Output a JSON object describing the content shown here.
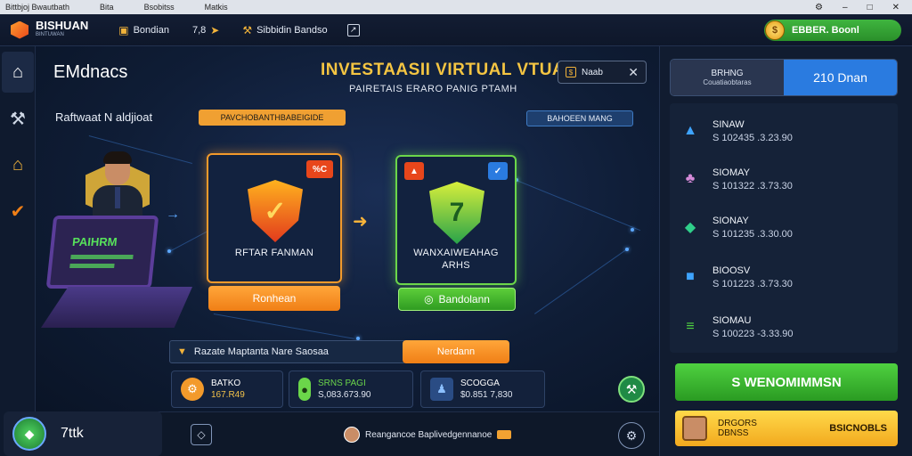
{
  "titlebar": {
    "items": [
      "Bittbjoj Bwautbath",
      "Bita",
      "Bsobitss",
      "Matkis"
    ],
    "controls": [
      "⚙",
      "–",
      "□",
      "✕"
    ]
  },
  "header": {
    "logo": "BISHUAN",
    "logo_sub": "BINTUWAN",
    "items": [
      "Bondian",
      "7,8",
      "Sibbidin Bandso"
    ],
    "balance": "EBBER. Boonl",
    "coin_label": "$"
  },
  "sidebar": {
    "items": [
      "home",
      "tools",
      "house",
      "ticket"
    ]
  },
  "main": {
    "heading": "EMdnacs",
    "title": "INVESTAASII VIRTUAL VTUAL",
    "subtitle": "PAIRETAIS ERARO PANIG PTAMH",
    "chip_label": "Naab",
    "sub_heading": "Raftwaat N aldjioat",
    "orange_tag": "PAVCHOBANTHBABEIGIDE",
    "blue_tag": "BAHOEEN MANG",
    "laptop_text": "PAIHRM",
    "left_card": {
      "corner": "%C",
      "label": "RFTAR FANMAN",
      "button": "Ronhean"
    },
    "right_card": {
      "label_line1": "WANXAIWEAHAG",
      "label_line2": "ARHS",
      "button": "Bandolann"
    },
    "info_bar": "Razate Maptanta Nare Saosaa",
    "info_button": "Nerdann",
    "stats": [
      {
        "title": "BATKO",
        "value": "167.R49",
        "icon": "●"
      },
      {
        "title": "SRNS PAGI",
        "value": "S,083.673.90",
        "icon": "•"
      },
      {
        "title": "SCOGGA",
        "value": "$0.851 7,830",
        "icon": "♟"
      }
    ]
  },
  "bottom": {
    "badge_label": "7ttk",
    "message": "Reangancoe Baplivedgennanoe"
  },
  "rpanel": {
    "tab_inactive_title": "BRHNG",
    "tab_inactive_sub": "Couatiaobtaras",
    "tab_active": "210 Dnan",
    "items": [
      {
        "name": "SINAW",
        "value": "S 102435 .3.23.90",
        "icon": "▲",
        "color": "#3ea4ff"
      },
      {
        "name": "SIOMAY",
        "value": "S 101322 .3.73.30",
        "icon": "♣",
        "color": "#d58ad8"
      },
      {
        "name": "SIONAY",
        "value": "S 101235 .3.30.00",
        "icon": "◆",
        "color": "#2fcf8a"
      },
      {
        "name": "BIOOSV",
        "value": "S 101223 .3.73.30",
        "icon": "■",
        "color": "#3ea4ff"
      },
      {
        "name": "SIOMAU",
        "value": "S 100223 -3.33.90",
        "icon": "≡",
        "color": "#4fd140"
      }
    ],
    "green_button": "S WENOMIMMSN",
    "promo_name_line1": "DRGORS",
    "promo_name_line2": "DBNSS",
    "promo_cta": "BSICNOBLS"
  }
}
